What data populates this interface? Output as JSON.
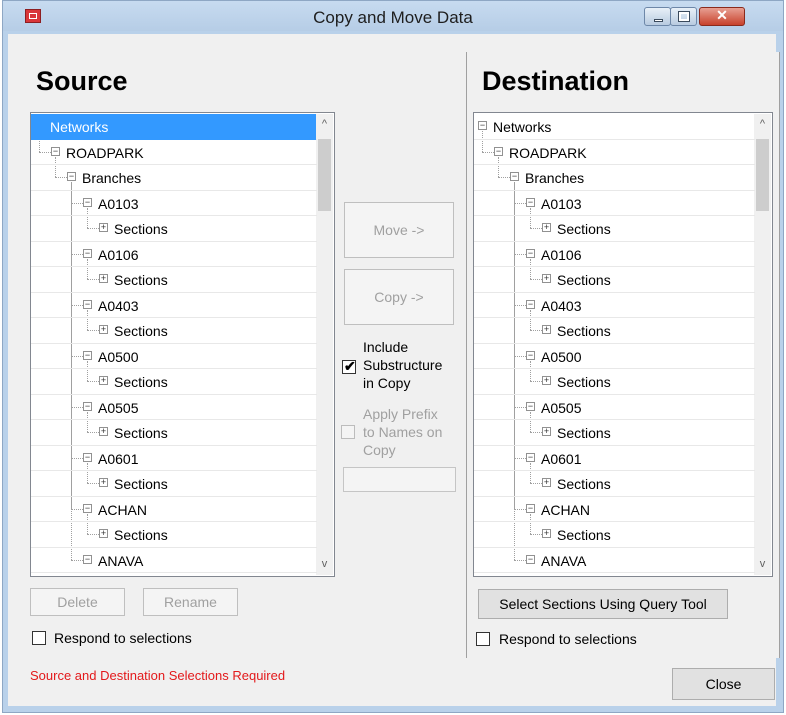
{
  "window": {
    "title": "Copy and Move Data",
    "close_glyph": "✕",
    "icon": "app-icon"
  },
  "source": {
    "heading": "Source",
    "tree": [
      {
        "label": "Networks",
        "level": 0,
        "toggle": "−",
        "selected": true
      },
      {
        "label": "ROADPARK",
        "level": 1,
        "toggle": "−"
      },
      {
        "label": "Branches",
        "level": 2,
        "toggle": "−"
      },
      {
        "label": "A0103",
        "level": 3,
        "toggle": "−"
      },
      {
        "label": "Sections",
        "level": 4,
        "toggle": "+"
      },
      {
        "label": "A0106",
        "level": 3,
        "toggle": "−"
      },
      {
        "label": "Sections",
        "level": 4,
        "toggle": "+"
      },
      {
        "label": "A0403",
        "level": 3,
        "toggle": "−"
      },
      {
        "label": "Sections",
        "level": 4,
        "toggle": "+"
      },
      {
        "label": "A0500",
        "level": 3,
        "toggle": "−"
      },
      {
        "label": "Sections",
        "level": 4,
        "toggle": "+"
      },
      {
        "label": "A0505",
        "level": 3,
        "toggle": "−"
      },
      {
        "label": "Sections",
        "level": 4,
        "toggle": "+"
      },
      {
        "label": "A0601",
        "level": 3,
        "toggle": "−"
      },
      {
        "label": "Sections",
        "level": 4,
        "toggle": "+"
      },
      {
        "label": "ACHAN",
        "level": 3,
        "toggle": "−"
      },
      {
        "label": "Sections",
        "level": 4,
        "toggle": "+"
      },
      {
        "label": "ANAVA",
        "level": 3,
        "toggle": "−"
      }
    ],
    "delete_label": "Delete",
    "rename_label": "Rename",
    "respond_label": "Respond to selections"
  },
  "middle": {
    "move_label": "Move ->",
    "copy_label": "Copy ->",
    "include_substructure_label": "Include Substructure in Copy",
    "include_substructure_checked": true,
    "apply_prefix_label": "Apply Prefix to Names on Copy",
    "apply_prefix_checked": false,
    "checkmark": "✔"
  },
  "destination": {
    "heading": "Destination",
    "tree": [
      {
        "label": "Networks",
        "level": 0,
        "toggle": "−"
      },
      {
        "label": "ROADPARK",
        "level": 1,
        "toggle": "−"
      },
      {
        "label": "Branches",
        "level": 2,
        "toggle": "−"
      },
      {
        "label": "A0103",
        "level": 3,
        "toggle": "−"
      },
      {
        "label": "Sections",
        "level": 4,
        "toggle": "+"
      },
      {
        "label": "A0106",
        "level": 3,
        "toggle": "−"
      },
      {
        "label": "Sections",
        "level": 4,
        "toggle": "+"
      },
      {
        "label": "A0403",
        "level": 3,
        "toggle": "−"
      },
      {
        "label": "Sections",
        "level": 4,
        "toggle": "+"
      },
      {
        "label": "A0500",
        "level": 3,
        "toggle": "−"
      },
      {
        "label": "Sections",
        "level": 4,
        "toggle": "+"
      },
      {
        "label": "A0505",
        "level": 3,
        "toggle": "−"
      },
      {
        "label": "Sections",
        "level": 4,
        "toggle": "+"
      },
      {
        "label": "A0601",
        "level": 3,
        "toggle": "−"
      },
      {
        "label": "Sections",
        "level": 4,
        "toggle": "+"
      },
      {
        "label": "ACHAN",
        "level": 3,
        "toggle": "−"
      },
      {
        "label": "Sections",
        "level": 4,
        "toggle": "+"
      },
      {
        "label": "ANAVA",
        "level": 3,
        "toggle": "−"
      }
    ],
    "query_button_label": "Select Sections Using Query Tool",
    "respond_label": "Respond to selections"
  },
  "status_message": "Source and Destination Selections Required",
  "close_label": "Close",
  "scroll_up_glyph": "^",
  "scroll_down_glyph": "v",
  "colors": {
    "selection": "#3399ff",
    "status_error": "#e3191b",
    "window_frame": "#b9d1ea"
  }
}
